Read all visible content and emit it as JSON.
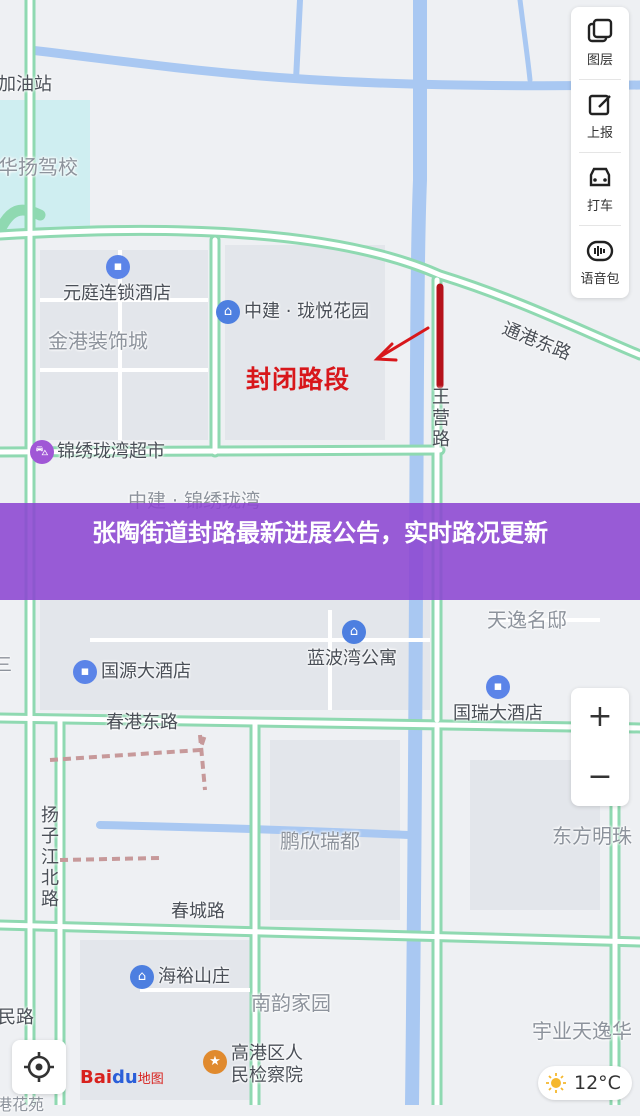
{
  "map": {
    "labels": {
      "gas_station": "加油站",
      "driving_school": "华扬驾校",
      "hotel_yuanting": "元庭连锁酒店",
      "decoration_city": "金港装饰城",
      "garden_zhongjian": "中建 · 珑悦花园",
      "supermarket": "锦绣珑湾超市",
      "community_jinxiu": "中建 · 锦绣珑湾",
      "road_tonggang": "通港东路",
      "road_wangying": "王营路",
      "tianyi_mansion": "天逸名邸",
      "hotel_guoyuan": "国源大酒店",
      "apartment_lanbo": "蓝波湾公寓",
      "hotel_guorui": "国瑞大酒店",
      "road_chungang": "春港东路",
      "road_yangzijiang": "扬子江北路",
      "pengxin_ruidu": "鹏欣瑞都",
      "dongfang_mingzhu": "东方明珠",
      "road_chuncheng": "春城路",
      "haiyu_villa": "海裕山庄",
      "nanyun_garden": "南韵家园",
      "procuratorate": "高港区人民检察院",
      "yuye_tianyi": "宇业天逸华",
      "minju_road": "民路",
      "san": "三",
      "edge_bottom_left": "港花苑"
    },
    "closed_section_label": "封闭路段"
  },
  "toolbar": {
    "items": [
      {
        "label": "图层",
        "icon": "layers-icon"
      },
      {
        "label": "上报",
        "icon": "report-icon"
      },
      {
        "label": "打车",
        "icon": "taxi-icon"
      },
      {
        "label": "语音包",
        "icon": "voice-pack-icon"
      }
    ]
  },
  "zoom": {
    "in": "+",
    "out": "−"
  },
  "banner": {
    "title": "张陶街道封路最新进展公告，实时路况更新"
  },
  "logo": {
    "text_bai": "Bai",
    "text_du": "du",
    "text_map": "地图"
  },
  "weather": {
    "temperature": "12°C",
    "icon": "sun-icon"
  },
  "colors": {
    "road_outline": "#7dd3a6",
    "water": "#a9c8f2",
    "closed_road": "#b5121b",
    "banner": "#8c46d2"
  }
}
